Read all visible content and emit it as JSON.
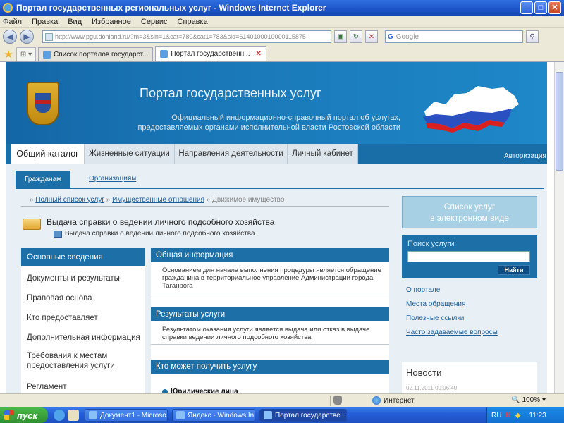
{
  "window": {
    "title": "Портал государственных региональных услуг - Windows Internet Explorer"
  },
  "menu": [
    "Файл",
    "Правка",
    "Вид",
    "Избранное",
    "Сервис",
    "Справка"
  ],
  "address": {
    "url": "http://www.pgu.donland.ru/?m=3&sin=1&cat=780&cat1=783&sid=6140100010000115875",
    "search_placeholder": "Google"
  },
  "browser_tabs": [
    {
      "label": "Список порталов государст...",
      "active": false
    },
    {
      "label": "Портал государственн...",
      "active": true
    }
  ],
  "site": {
    "title": "Портал государственных услуг",
    "subtitle_line1": "Официальный информационно-справочный портал об услугах,",
    "subtitle_line2": "предоставляемых органами исполнительной власти Ростовской области",
    "nav_tabs": [
      "Общий каталог",
      "Жизненные ситуации",
      "Направления деятельности",
      "Личный кабинет"
    ],
    "auth_link": "Авторизация",
    "sub_tabs": {
      "active": "Гражданам",
      "other": "Организациям"
    },
    "breadcrumb": {
      "prefix": "»",
      "item1": "Полный список услуг",
      "sep1": "»",
      "item2": "Имущественные отношения",
      "sep2": "»",
      "current": "Движимое имущество"
    },
    "service_title": "Выдача справки о ведении личного подсобного хозяйства",
    "service_subtitle": "Выдача справки о ведении личного подсобного хозяйства",
    "left_menu": [
      "Основные сведения",
      "Документы и результаты",
      "Правовая основа",
      "Кто предоставляет",
      "Дополнительная информация",
      "Требования к местам предоставления услуги",
      "Регламент"
    ],
    "sections": [
      {
        "title": "Общая информация",
        "text": "Основанием для начала выполнения процедуры является обращение гражданина в территориальное управление Администрации города Таганрога"
      },
      {
        "title": "Результаты услуги",
        "text": "Результатом оказания услуги является выдача или отказ в выдаче справки ведении личного подсобного хозяйства"
      },
      {
        "title": "Кто может получить услугу",
        "text": ""
      }
    ],
    "entity_label": "Юридические лица",
    "e_services_line1": "Список услуг",
    "e_services_line2": "в электронном виде",
    "search": {
      "label": "Поиск услуги",
      "button": "Найти"
    },
    "right_links": [
      "О портале",
      "Места обращения",
      "Полезные ссылки",
      "Часто задаваемые вопросы"
    ],
    "news": {
      "title": "Новости",
      "date": "02.11.2011 09:06:40"
    }
  },
  "status": {
    "zone": "Интернет",
    "zoom": "100%"
  },
  "taskbar": {
    "start": "пуск",
    "tasks": [
      "Документ1 - Microso...",
      "Яндекс - Windows In...",
      "Портал государстве..."
    ],
    "lang": "RU",
    "clock": "11:23"
  }
}
